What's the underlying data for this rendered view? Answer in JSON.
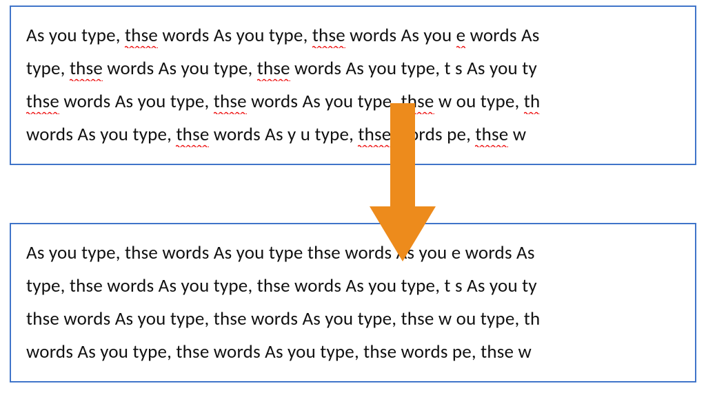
{
  "arrow": {
    "color": "#ed8b1c"
  },
  "top": {
    "spellcheck": true,
    "lines": [
      [
        {
          "t": "As you type, "
        },
        {
          "t": "thse",
          "sq": true
        },
        {
          "t": " words As you type, "
        },
        {
          "t": "thse",
          "sq": true
        },
        {
          "t": " words As you "
        },
        {
          "t": "e",
          "sq": true
        },
        {
          "t": " words As"
        }
      ],
      [
        {
          "t": "type, "
        },
        {
          "t": "thse",
          "sq": true
        },
        {
          "t": " words As you type, "
        },
        {
          "t": "thse",
          "sq": true
        },
        {
          "t": " words As you type, t s As you ty"
        }
      ],
      [
        {
          "t": "thse",
          "sq": true
        },
        {
          "t": " words As you type, "
        },
        {
          "t": "thse",
          "sq": true
        },
        {
          "t": " words As you type, "
        },
        {
          "t": "thse",
          "sq": true
        },
        {
          "t": " w ou type, "
        },
        {
          "t": "th",
          "sq": true
        }
      ],
      [
        {
          "t": "words As you type, "
        },
        {
          "t": "thse",
          "sq": true
        },
        {
          "t": " words As y u type, "
        },
        {
          "t": "thse",
          "sq": true
        },
        {
          "t": " words pe, "
        },
        {
          "t": "thse",
          "sq": true
        },
        {
          "t": " w"
        }
      ]
    ]
  },
  "bottom": {
    "spellcheck": false,
    "lines": [
      [
        {
          "t": "As you type, thse words As you type  thse words As you e words As"
        }
      ],
      [
        {
          "t": "type, thse words As you type, thse words As you type, t s As you ty"
        }
      ],
      [
        {
          "t": "thse words As you type, thse words As you type, thse w ou type, th"
        }
      ],
      [
        {
          "t": "words As you type, thse words As you type, thse words pe, thse w"
        }
      ]
    ]
  }
}
